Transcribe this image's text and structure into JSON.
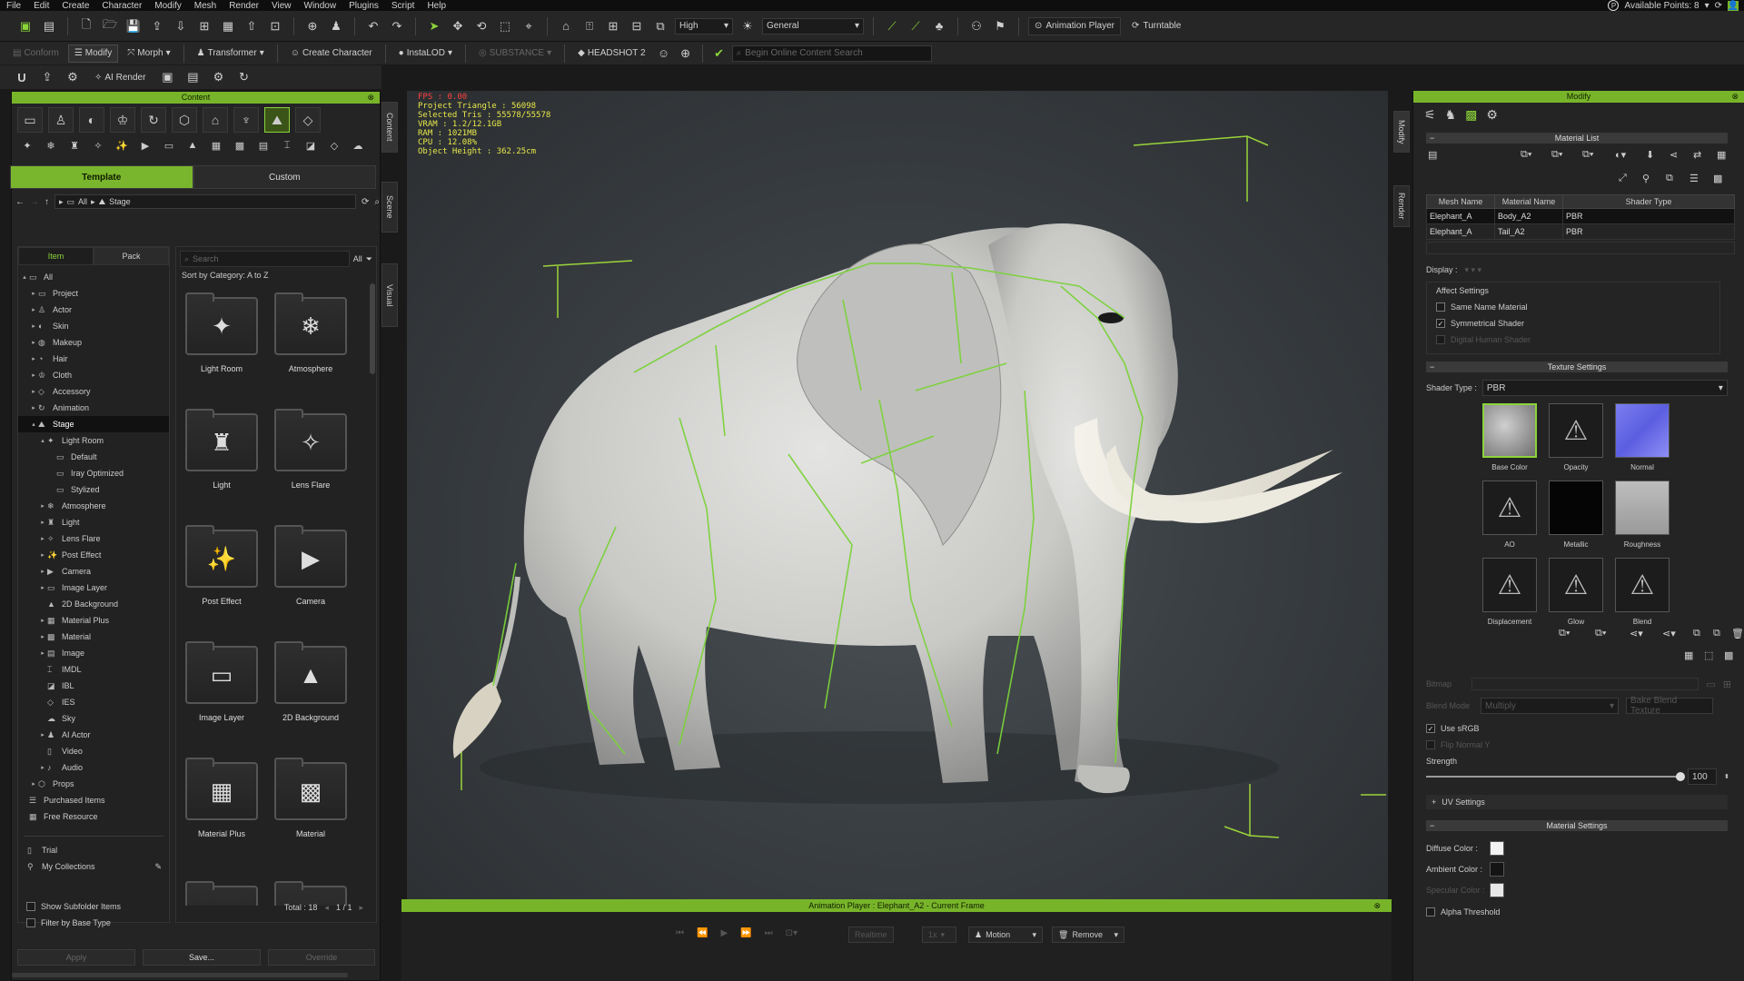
{
  "menu": [
    "File",
    "Edit",
    "Create",
    "Character",
    "Modify",
    "Mesh",
    "Render",
    "View",
    "Window",
    "Plugins",
    "Script",
    "Help"
  ],
  "available_points": "Available Points: 8",
  "toolbar": {
    "quality": "High",
    "preset": "General",
    "animation_player": "Animation Player",
    "turntable": "Turntable"
  },
  "toolbar2": {
    "conform": "Conform",
    "modify": "Modify",
    "morph": "Morph",
    "transformer": "Transformer",
    "create_character": "Create Character",
    "instaLOD": "InstaLOD",
    "substance": "SUBSTANCE",
    "headshot": "HEADSHOT 2",
    "search_placeholder": "Begin Online Content Search"
  },
  "toolbar3": {
    "ai_render": "AI Render"
  },
  "content": {
    "title": "Content",
    "tab_template": "Template",
    "tab_custom": "Custom",
    "path": [
      "All",
      "Stage"
    ],
    "subtab_item": "Item",
    "subtab_pack": "Pack",
    "search_placeholder": "Search",
    "filter": "All",
    "sort": "Sort by Category: A to Z",
    "tree": [
      {
        "label": "All",
        "indent": 0,
        "arrow": "▴"
      },
      {
        "label": "Project",
        "indent": 1,
        "arrow": "▸"
      },
      {
        "label": "Actor",
        "indent": 1,
        "arrow": "▸"
      },
      {
        "label": "Skin",
        "indent": 1,
        "arrow": "▸"
      },
      {
        "label": "Makeup",
        "indent": 1,
        "arrow": "▸"
      },
      {
        "label": "Hair",
        "indent": 1,
        "arrow": "▸"
      },
      {
        "label": "Cloth",
        "indent": 1,
        "arrow": "▸"
      },
      {
        "label": "Accessory",
        "indent": 1,
        "arrow": "▸"
      },
      {
        "label": "Animation",
        "indent": 1,
        "arrow": "▸"
      },
      {
        "label": "Stage",
        "indent": 1,
        "arrow": "▴",
        "sel": true
      },
      {
        "label": "Light Room",
        "indent": 2,
        "arrow": "▴"
      },
      {
        "label": "Default",
        "indent": 3,
        "arrow": ""
      },
      {
        "label": "Iray Optimized",
        "indent": 3,
        "arrow": ""
      },
      {
        "label": "Stylized",
        "indent": 3,
        "arrow": ""
      },
      {
        "label": "Atmosphere",
        "indent": 2,
        "arrow": "▸"
      },
      {
        "label": "Light",
        "indent": 2,
        "arrow": "▸"
      },
      {
        "label": "Lens Flare",
        "indent": 2,
        "arrow": "▸"
      },
      {
        "label": "Post Effect",
        "indent": 2,
        "arrow": "▸"
      },
      {
        "label": "Camera",
        "indent": 2,
        "arrow": "▸"
      },
      {
        "label": "Image Layer",
        "indent": 2,
        "arrow": "▸"
      },
      {
        "label": "2D Background",
        "indent": 2,
        "arrow": ""
      },
      {
        "label": "Material Plus",
        "indent": 2,
        "arrow": "▸"
      },
      {
        "label": "Material",
        "indent": 2,
        "arrow": "▸"
      },
      {
        "label": "Image",
        "indent": 2,
        "arrow": "▸"
      },
      {
        "label": "IMDL",
        "indent": 2,
        "arrow": ""
      },
      {
        "label": "IBL",
        "indent": 2,
        "arrow": ""
      },
      {
        "label": "IES",
        "indent": 2,
        "arrow": ""
      },
      {
        "label": "Sky",
        "indent": 2,
        "arrow": ""
      },
      {
        "label": "AI Actor",
        "indent": 2,
        "arrow": "▸"
      },
      {
        "label": "Video",
        "indent": 2,
        "arrow": ""
      },
      {
        "label": "Audio",
        "indent": 2,
        "arrow": "▸"
      },
      {
        "label": "Props",
        "indent": 1,
        "arrow": "▸"
      },
      {
        "label": "Purchased Items",
        "indent": 0,
        "arrow": ""
      },
      {
        "label": "Free Resource",
        "indent": 0,
        "arrow": ""
      }
    ],
    "trial": "Trial",
    "my_collections": "My Collections",
    "tiles": [
      {
        "label": "Light Room",
        "glyph": "✦"
      },
      {
        "label": "Atmosphere",
        "glyph": "❄"
      },
      {
        "label": "Light",
        "glyph": "♜"
      },
      {
        "label": "Lens Flare",
        "glyph": "✧"
      },
      {
        "label": "Post Effect",
        "glyph": "✨"
      },
      {
        "label": "Camera",
        "glyph": "▶"
      },
      {
        "label": "Image Layer",
        "glyph": "▭"
      },
      {
        "label": "2D Background",
        "glyph": "▲"
      },
      {
        "label": "Material Plus",
        "glyph": "▦"
      },
      {
        "label": "Material",
        "glyph": "▩"
      }
    ],
    "show_subfolder": "Show Subfolder Items",
    "filter_base": "Filter by Base Type",
    "total_label": "Total : 18",
    "page_label": "1 / 1",
    "apply": "Apply",
    "save": "Save...",
    "override": "Override"
  },
  "side_tabs": [
    "Content",
    "Scene",
    "Visual"
  ],
  "stats": {
    "fps": "FPS : 0.00",
    "lines": [
      "Project Triangle : 56098",
      "Selected Tris : 55578/55578",
      "VRAM : 1.2/12.1GB",
      "RAM : 1021MB",
      "CPU : 12.08%",
      "Object Height : 362.25cm"
    ]
  },
  "anim": {
    "title": "Animation Player : Elephant_A2 - Current Frame",
    "realtime": "Realtime",
    "speed": "1x",
    "motion": "Motion",
    "remove": "Remove"
  },
  "modify_tabs": [
    "Modify",
    "Render"
  ],
  "modify": {
    "title": "Modify",
    "material_list": "Material List",
    "columns": [
      "Mesh Name",
      "Material Name",
      "Shader Type"
    ],
    "rows": [
      {
        "mesh": "Elephant_A",
        "mat": "Body_A2",
        "shader": "PBR",
        "sel": true
      },
      {
        "mesh": "Elephant_A",
        "mat": "Tail_A2",
        "shader": "PBR",
        "sel": false
      }
    ],
    "display": "Display :",
    "affect": "Affect Settings",
    "same_name": "Same Name Material",
    "symmetrical": "Symmetrical Shader",
    "digital_human": "Digital Human Shader",
    "texture_settings": "Texture Settings",
    "shader_type_label": "Shader Type :",
    "shader_type": "PBR",
    "textures": [
      "Base Color",
      "Opacity",
      "Normal",
      "AO",
      "Metallic",
      "Roughness",
      "Displacement",
      "Glow",
      "Blend"
    ],
    "bitmap": "Bitmap",
    "blend_mode": "Blend Mode",
    "multiply": "Multiply",
    "bake_blend": "Bake Blend Texture",
    "use_srgb": "Use sRGB",
    "flip_normal": "Flip Normal Y",
    "strength": "Strength",
    "strength_value": "100",
    "strength_fraction": 1.0,
    "uv_settings": "UV Settings",
    "material_settings": "Material Settings",
    "diffuse": "Diffuse Color :",
    "ambient": "Ambient Color :",
    "specular": "Specular Color :",
    "alpha": "Alpha Threshold",
    "colors": {
      "diffuse": "#f2f2f2",
      "ambient": "#141414",
      "specular": "#e8e8e8"
    }
  }
}
